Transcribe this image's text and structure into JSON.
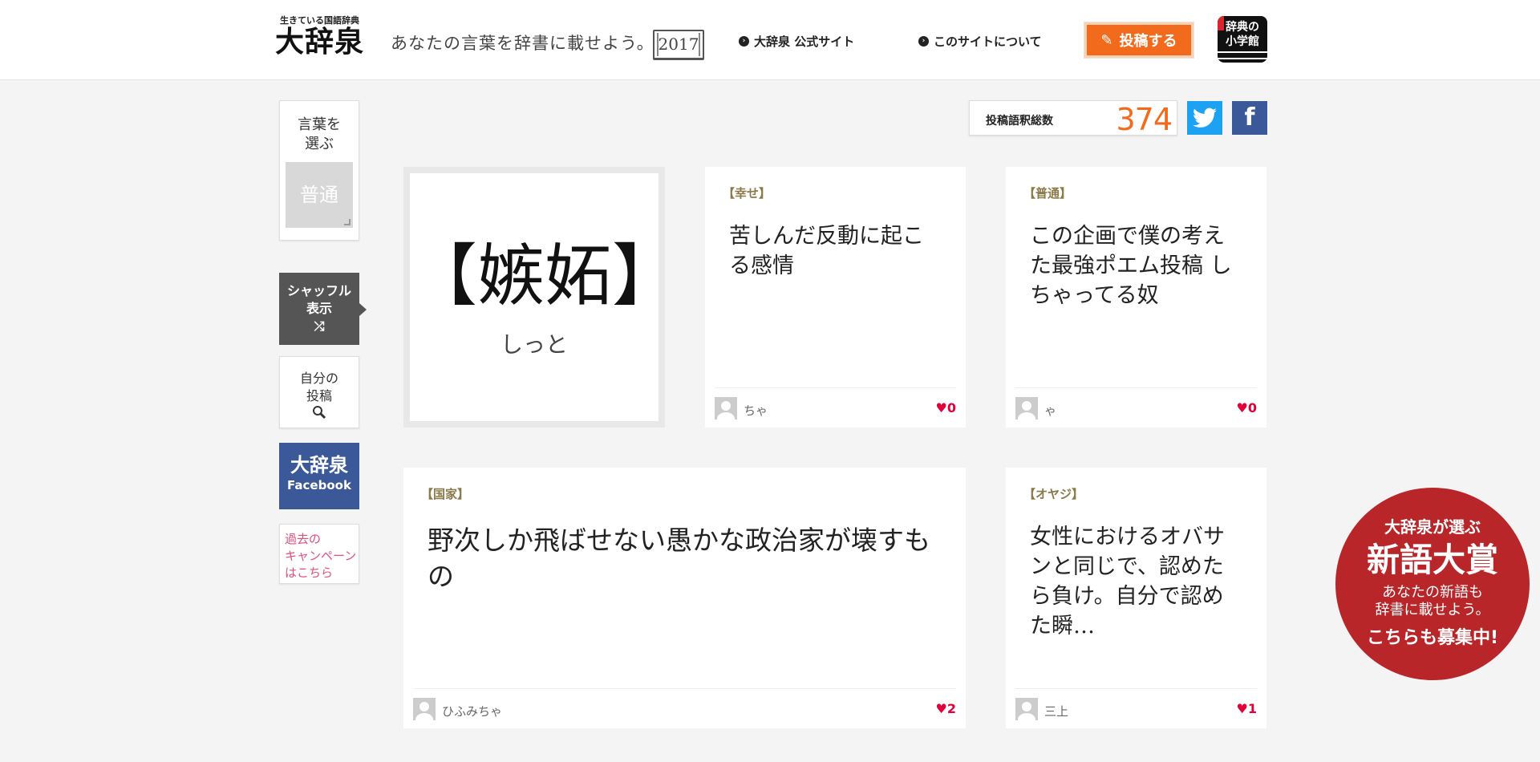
{
  "header": {
    "logo_sub": "生きている国語辞典",
    "logo_main": "大辞泉",
    "tagline": "あなたの言葉を辞書に載せよう。",
    "year": "2017",
    "nav_official": "大辞泉 公式サイト",
    "nav_about": "このサイトについて",
    "post_button": "投稿する",
    "publisher_line1": "辞典の",
    "publisher_line2": "小学館"
  },
  "sidebar": {
    "choose_line1": "言葉を",
    "choose_line2": "選ぶ",
    "selected_word": "普通",
    "shuffle_line1": "シャッフル",
    "shuffle_line2": "表示",
    "shuffle_icon": "⤮",
    "mine_line1": "自分の",
    "mine_line2": "投稿",
    "fb_line1": "大辞泉",
    "fb_line2": "Facebook",
    "past_line1": "過去の",
    "past_line2": "キャンペーン",
    "past_line3": "はこちら"
  },
  "counter": {
    "label": "投稿語釈総数",
    "value": "374"
  },
  "social": {
    "twitter_glyph": "t",
    "facebook_glyph": "f"
  },
  "featured": {
    "word": "【嫉妬】",
    "reading": "しっと"
  },
  "cards": [
    {
      "tag": "【幸せ】",
      "text": "苦しんだ反動に起こる感情",
      "user": "ちゃ",
      "likes": "0"
    },
    {
      "tag": "【普通】",
      "text": "この企画で僕の考えた最強ポエム投稿 しちゃってる奴",
      "user": "ゃ",
      "likes": "0"
    },
    {
      "tag": "【国家】",
      "text": "野次しか飛ばせない愚かな政治家が壊すもの",
      "user": "ひふみちゃ",
      "likes": "2"
    },
    {
      "tag": "【オヤジ】",
      "text": "女性におけるオバサンと同じで、認めたら負け。自分で認めた瞬…",
      "user": "三上",
      "likes": "1"
    }
  ],
  "heart": "♥",
  "award": {
    "line1": "大辞泉が選ぶ",
    "line2": "新語大賞",
    "line3": "あなたの新語も",
    "line4": "辞書に載せよう。",
    "line5": "こちらも募集中!"
  },
  "colors": {
    "accent": "#f26a1b",
    "award": "#b8262a",
    "facebook": "#3b5998",
    "twitter": "#1da1f2",
    "like": "#e0003a"
  }
}
